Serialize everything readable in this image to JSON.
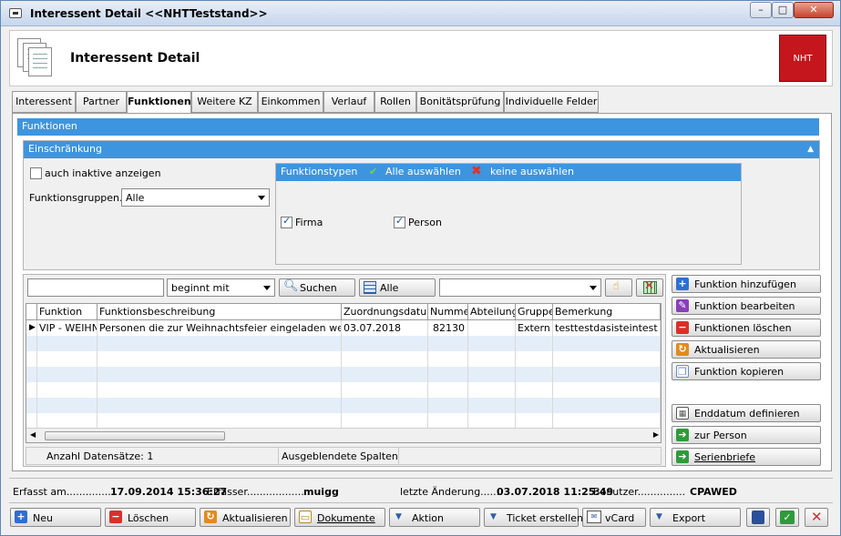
{
  "window": {
    "title": "Interessent Detail  <<NHTTeststand>>"
  },
  "header": {
    "title": "Interessent Detail",
    "logo_text": "NHT"
  },
  "tabs": [
    "Interessent",
    "Partner",
    "Funktionen",
    "Weitere KZ",
    "Einkommen",
    "Verlauf",
    "Rollen",
    "Bonitätsprüfung",
    "Individuelle Felder"
  ],
  "active_tab": "Funktionen",
  "funktionen_panel": {
    "title": "Funktionen"
  },
  "einschraenkung": {
    "title": "Einschränkung",
    "inactive_label": "auch inaktive anzeigen",
    "inactive_checked": false,
    "gruppen_label": "Funktionsgruppen....",
    "gruppen_value": "Alle",
    "typen": {
      "title": "Funktionstypen",
      "select_all": "Alle auswählen",
      "select_none": "keine auswählen",
      "firma": "Firma",
      "firma_checked": true,
      "person": "Person",
      "person_checked": true
    }
  },
  "search": {
    "text": "",
    "mode": "beginnt mit",
    "search_button": "Suchen",
    "all_button": "Alle",
    "field": ""
  },
  "table": {
    "columns": [
      "Funktion",
      "Funktionsbeschreibung",
      "Zuordnungsdatum",
      "Nummer",
      "Abteilung",
      "Gruppe",
      "Bemerkung"
    ],
    "rows": [
      {
        "funktion": "VIP - WEIHN",
        "beschreibung": "Personen die zur Weihnachtsfeier eingeladen werden.",
        "datum": "03.07.2018",
        "nummer": "82130",
        "abteilung": "",
        "gruppe": "Extern",
        "bemerkung": "testtestdasisteintest"
      }
    ],
    "count_label": "Anzahl Datensätze: 1",
    "hidden_cols_label": "Ausgeblendete Spalten"
  },
  "side_buttons": {
    "add": "Funktion hinzufügen",
    "edit": "Funktion bearbeiten",
    "delete": "Funktionen löschen",
    "refresh": "Aktualisieren",
    "copy": "Funktion kopieren",
    "enddate": "Enddatum definieren",
    "to_person": "zur Person",
    "serienbriefe": "Serienbriefe"
  },
  "footer": {
    "erfasst_label": "Erfasst am................",
    "erfasst_value": "17.09.2014 15:36:27",
    "erfasser_label": "Erfasser..................",
    "erfasser_value": "muigg",
    "aenderung_label": "letzte Änderung.......",
    "aenderung_value": "03.07.2018 11:25:49",
    "benutzer_label": "Benutzer...............",
    "benutzer_value": "CPAWED"
  },
  "bottom_buttons": {
    "neu": "Neu",
    "loeschen": "Löschen",
    "aktualisieren": "Aktualisieren",
    "dokumente": "Dokumente",
    "aktion": "Aktion",
    "ticket": "Ticket erstellen",
    "vcard": "vCard",
    "export": "Export"
  },
  "colors": {
    "accent": "#3d95e0",
    "logo": "#c4161c"
  }
}
